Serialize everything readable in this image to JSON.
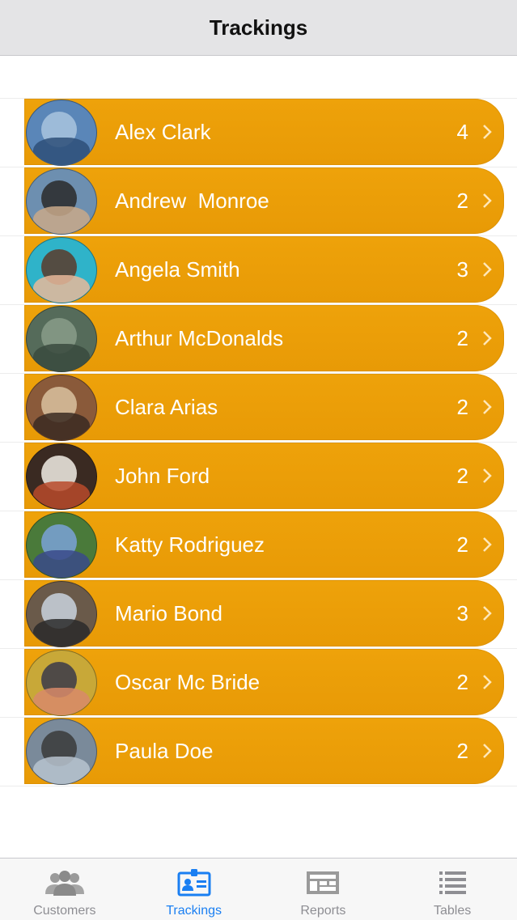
{
  "nav": {
    "title": "Trackings"
  },
  "rows": [
    {
      "name": "Alex Clark",
      "count": "4",
      "avatar": "avatar-building"
    },
    {
      "name": "Andrew  Monroe",
      "count": "2",
      "avatar": "avatar-man"
    },
    {
      "name": "Angela Smith",
      "count": "3",
      "avatar": "avatar-woman-pool"
    },
    {
      "name": "Arthur McDonalds",
      "count": "2",
      "avatar": "avatar-landscape"
    },
    {
      "name": "Clara Arias",
      "count": "2",
      "avatar": "avatar-store"
    },
    {
      "name": "John Ford",
      "count": "2",
      "avatar": "avatar-food"
    },
    {
      "name": "Katty Rodriguez",
      "count": "2",
      "avatar": "avatar-child"
    },
    {
      "name": "Mario Bond",
      "count": "3",
      "avatar": "avatar-people"
    },
    {
      "name": "Oscar Mc Bride",
      "count": "2",
      "avatar": "avatar-kids"
    },
    {
      "name": "Paula Doe",
      "count": "2",
      "avatar": "avatar-car"
    }
  ],
  "tabs": [
    {
      "label": "Customers",
      "icon": "customers-icon",
      "active": false
    },
    {
      "label": "Trackings",
      "icon": "trackings-icon",
      "active": true
    },
    {
      "label": "Reports",
      "icon": "reports-icon",
      "active": false
    },
    {
      "label": "Tables",
      "icon": "tables-icon",
      "active": false
    }
  ],
  "colors": {
    "row": "#eea20a",
    "tab_active": "#1a7ff2",
    "tab_inactive": "#8e8e93"
  }
}
